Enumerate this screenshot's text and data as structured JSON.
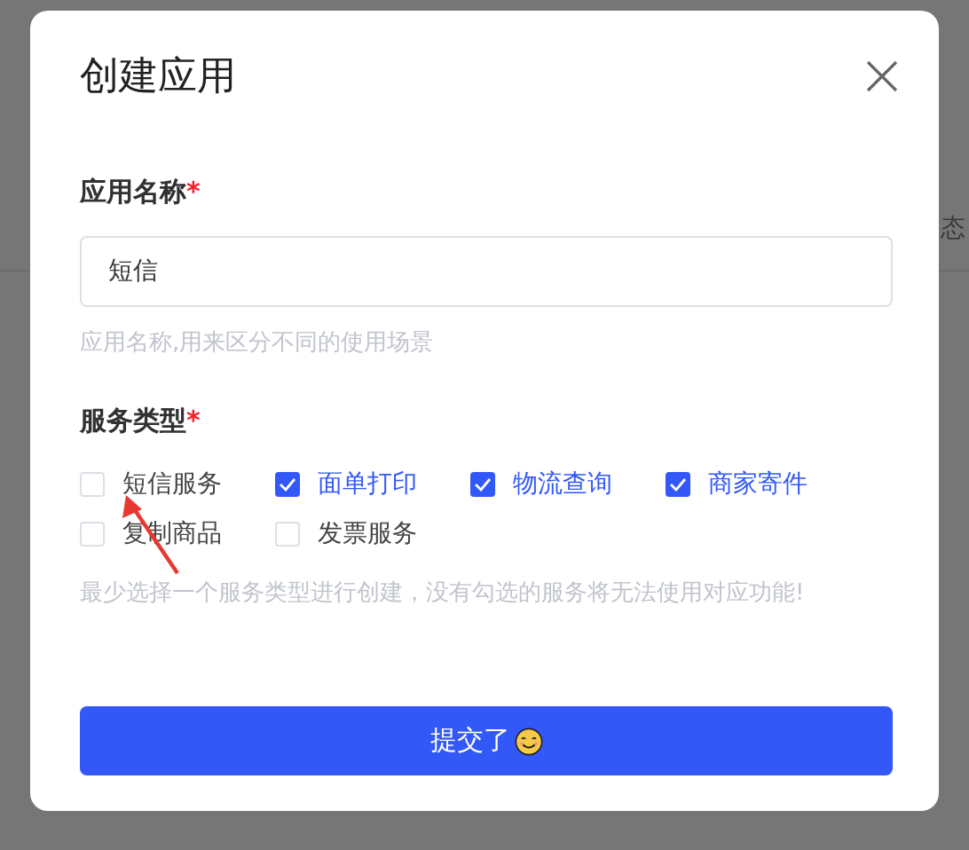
{
  "background": {
    "text": "态"
  },
  "dialog": {
    "title": "创建应用",
    "name_field": {
      "label": "应用名称",
      "required_mark": "*",
      "value": "短信",
      "hint": "应用名称,用来区分不同的使用场景"
    },
    "services": {
      "label": "服务类型",
      "required_mark": "*",
      "options": [
        {
          "label": "短信服务",
          "checked": false
        },
        {
          "label": "面单打印",
          "checked": true
        },
        {
          "label": "物流查询",
          "checked": true
        },
        {
          "label": "商家寄件",
          "checked": true
        },
        {
          "label": "复制商品",
          "checked": false
        },
        {
          "label": "发票服务",
          "checked": false
        }
      ],
      "hint": "最少选择一个服务类型进行创建，没有勾选的服务将无法使用对应功能!"
    },
    "submit": {
      "label": "提交了"
    }
  }
}
